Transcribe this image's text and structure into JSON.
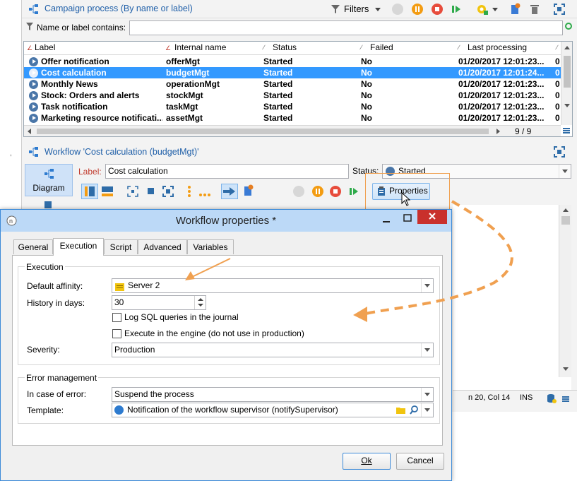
{
  "app": {
    "panel_title": "Campaign process (By name or label)",
    "filters_label": "Filters",
    "filter_label": "Name or label contains:",
    "filter_value": "",
    "columns": [
      "Label",
      "Internal name",
      "Status",
      "Failed",
      "Last processing"
    ],
    "rows": [
      {
        "label": "Offer notification",
        "internal": "offerMgt",
        "status": "Started",
        "failed": "No",
        "last": "01/20/2017 12:01:23...",
        "extra": "0"
      },
      {
        "label": "Cost calculation",
        "internal": "budgetMgt",
        "status": "Started",
        "failed": "No",
        "last": "01/20/2017 12:01:24...",
        "extra": "0"
      },
      {
        "label": "Monthly News",
        "internal": "operationMgt",
        "status": "Started",
        "failed": "No",
        "last": "01/20/2017 12:01:23...",
        "extra": "0"
      },
      {
        "label": "Stock: Orders and alerts",
        "internal": "stockMgt",
        "status": "Started",
        "failed": "No",
        "last": "01/20/2017 12:01:23...",
        "extra": "0"
      },
      {
        "label": "Task notification",
        "internal": "taskMgt",
        "status": "Started",
        "failed": "No",
        "last": "01/20/2017 12:01:23...",
        "extra": "0"
      },
      {
        "label": "Marketing resource notificati...",
        "internal": "assetMgt",
        "status": "Started",
        "failed": "No",
        "last": "01/20/2017 12:01:23...",
        "extra": "0"
      }
    ],
    "selected_row": 1,
    "row_count": "9 / 9",
    "workflow_title": "Workflow 'Cost calculation (budgetMgt)'",
    "diagram_label": "Diagram",
    "label_field_label": "Label:",
    "label_field_value": "Cost calculation",
    "status_field_label": "Status:",
    "status_field_value": "Started",
    "properties_label": "Properties",
    "statusbar_pos": "n 20, Col 14",
    "statusbar_mode": "INS"
  },
  "dialog": {
    "title": "Workflow properties *",
    "tabs": [
      "General",
      "Execution",
      "Script",
      "Advanced",
      "Variables"
    ],
    "active_tab": 1,
    "execution": {
      "group_title": "Execution",
      "affinity_label": "Default affinity:",
      "affinity_value": "Server 2",
      "history_label": "History in days:",
      "history_value": "30",
      "log_sql_label": "Log SQL queries in the journal",
      "execute_engine_label": "Execute in the engine (do not use in production)",
      "severity_label": "Severity:",
      "severity_value": "Production"
    },
    "error": {
      "group_title": "Error management",
      "on_error_label": "In case of error:",
      "on_error_value": "Suspend the process",
      "template_label": "Template:",
      "template_value": "Notification of the workflow supervisor (notifySupervisor)"
    },
    "ok_label": "Ok",
    "cancel_label": "Cancel"
  },
  "colors": {
    "accent": "#3399ff",
    "title_blue": "#1f5fa8",
    "annotation_orange": "#f0a050"
  }
}
